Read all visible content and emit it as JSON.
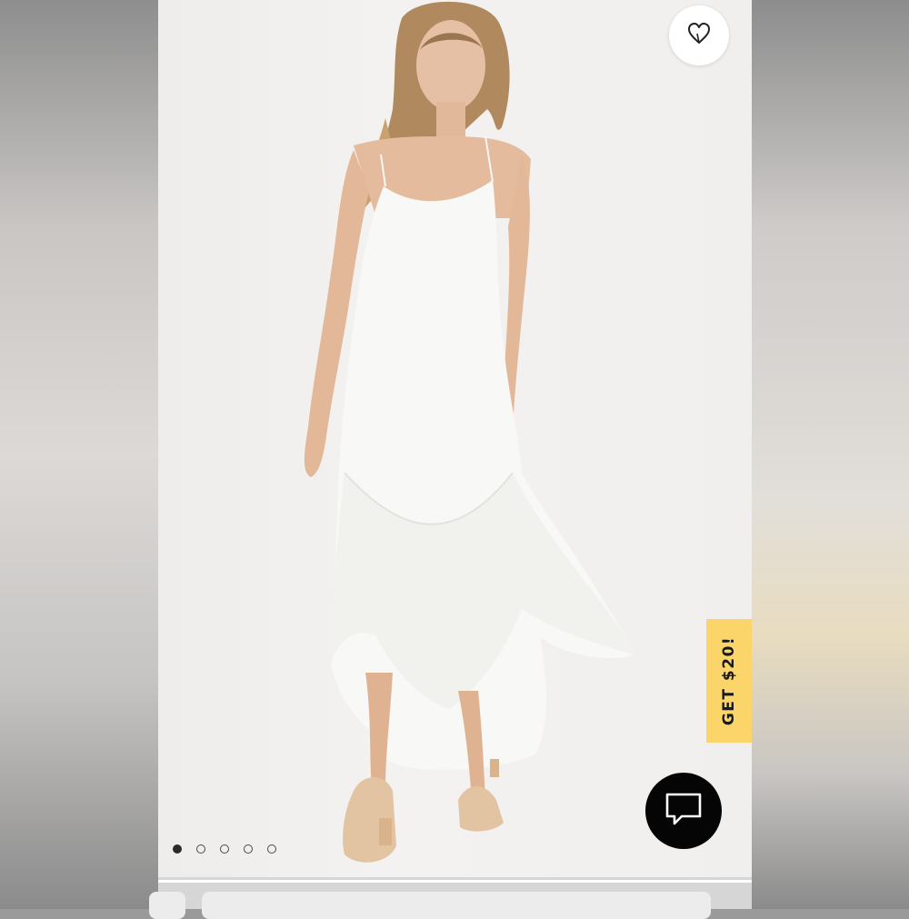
{
  "promo": {
    "label": "GET $20!",
    "color": "#fbd56a"
  },
  "icons": {
    "favorite": "heart-icon",
    "chat": "chat-bubble-icon"
  },
  "carousel": {
    "total": 5,
    "active_index": 0
  }
}
